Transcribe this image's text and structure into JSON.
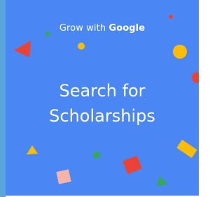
{
  "card": {
    "brand_prefix": "Grow with",
    "brand_name": "Google",
    "headline_line1": "Search for",
    "headline_line2": "Scholarships"
  },
  "colors": {
    "background": "#4b87f4",
    "edge": "#5aa6dc",
    "red": "#ea4335",
    "yellow": "#fbbc04",
    "green": "#34a853",
    "pink": "#f6b3a8",
    "text": "#ffffff"
  },
  "decorations": [
    "red-triangle-icon",
    "green-triangle-icon",
    "yellow-dot-icon",
    "red-dot-icon",
    "yellow-circle-icon",
    "red-circle-icon",
    "yellow-triangle-icon",
    "green-dot-icon",
    "pink-square-icon",
    "red-square-icon",
    "yellow-rectangle-icon",
    "green-triangle-bottom-icon"
  ]
}
